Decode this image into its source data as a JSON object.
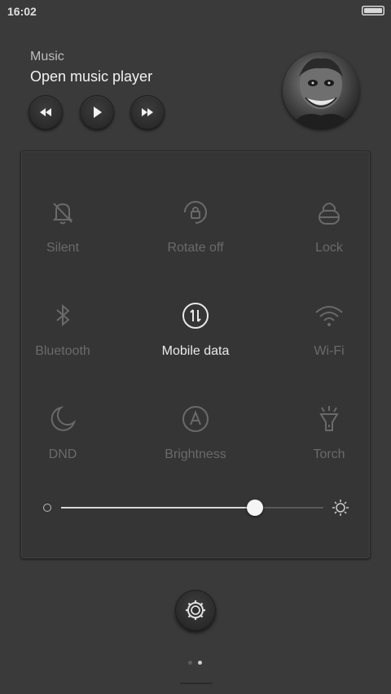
{
  "status_bar": {
    "time": "16:02",
    "battery_icon": "battery-icon"
  },
  "music": {
    "label": "Music",
    "title": "Open music player",
    "controls": [
      {
        "name": "rewind-icon"
      },
      {
        "name": "play-icon"
      },
      {
        "name": "fast-forward-icon"
      }
    ],
    "album_art": "album-art"
  },
  "toggles": [
    {
      "label": "Silent",
      "icon": "bell-off-icon",
      "active": false
    },
    {
      "label": "Rotate off",
      "icon": "rotate-lock-icon",
      "active": false
    },
    {
      "label": "Lock",
      "icon": "lock-icon",
      "active": false
    },
    {
      "label": "Bluetooth",
      "icon": "bluetooth-icon",
      "active": false
    },
    {
      "label": "Mobile data",
      "icon": "mobile-data-icon",
      "active": true
    },
    {
      "label": "Wi-Fi",
      "icon": "wifi-icon",
      "active": false
    },
    {
      "label": "DND",
      "icon": "moon-icon",
      "active": false
    },
    {
      "label": "Brightness",
      "icon": "auto-brightness-icon",
      "active": false
    },
    {
      "label": "Torch",
      "icon": "flashlight-icon",
      "active": false
    }
  ],
  "brightness": {
    "level_percent": 74
  },
  "settings_button": "gear-icon",
  "pager": {
    "pages": 2,
    "current": 2
  }
}
